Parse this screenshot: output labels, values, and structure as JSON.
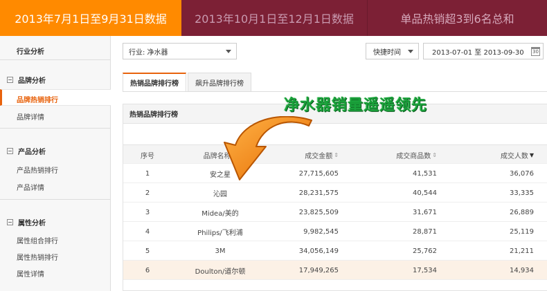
{
  "banner": {
    "tab1": "2013年7月1日至9月31日数据",
    "tab2": "2013年10月1日至12月1日数据",
    "tab3": "单品热销超3到6名总和"
  },
  "sidebar": {
    "industry_analysis": "行业分析",
    "sections": [
      {
        "title": "品牌分析",
        "items": [
          "品牌热销排行",
          "品牌详情"
        ],
        "active_item": "品牌热销排行"
      },
      {
        "title": "产品分析",
        "items": [
          "产品热销排行",
          "产品详情"
        ]
      },
      {
        "title": "属性分析",
        "items": [
          "属性组合排行",
          "属性热销排行",
          "属性详情"
        ]
      }
    ]
  },
  "filters": {
    "industry": "行业: 净水器",
    "time_mode": "快捷时间",
    "date_range": "2013-07-01 至 2013-09-30",
    "calendar_glyph": "30"
  },
  "tabs": [
    {
      "label": "热销品牌排行榜",
      "active": true
    },
    {
      "label": "飙升品牌排行榜",
      "active": false
    }
  ],
  "panel": {
    "title": "热销品牌排行榜"
  },
  "callout": "净水器销量遥遥领先",
  "table": {
    "headers": {
      "rank": "序号",
      "brand": "品牌名称",
      "amount": "成交金额",
      "count": "成交商品数",
      "buyers": "成交人数"
    },
    "sort_icons": {
      "brand": "⇕",
      "amount": "⇕",
      "count": "⇕",
      "buyers": "▼"
    },
    "rows": [
      {
        "rank": "1",
        "brand": "安之星",
        "amount": "27,715,605",
        "count": "41,531",
        "buyers": "36,076"
      },
      {
        "rank": "2",
        "brand": "沁园",
        "amount": "28,231,575",
        "count": "40,544",
        "buyers": "33,335"
      },
      {
        "rank": "3",
        "brand": "Midea/美的",
        "amount": "23,825,509",
        "count": "31,671",
        "buyers": "26,889"
      },
      {
        "rank": "4",
        "brand": "Philips/飞利浦",
        "amount": "9,982,545",
        "count": "28,871",
        "buyers": "25,119"
      },
      {
        "rank": "5",
        "brand": "3M",
        "amount": "34,056,149",
        "count": "25,762",
        "buyers": "21,211"
      },
      {
        "rank": "6",
        "brand": "Doulton/道尔顿",
        "amount": "17,949,265",
        "count": "17,534",
        "buyers": "14,934"
      }
    ]
  },
  "colors": {
    "accent": "#ff8a00",
    "banner_dark": "#7c2035",
    "callout_green": "#1aa23b",
    "arrow_orange": "#f5820a"
  }
}
